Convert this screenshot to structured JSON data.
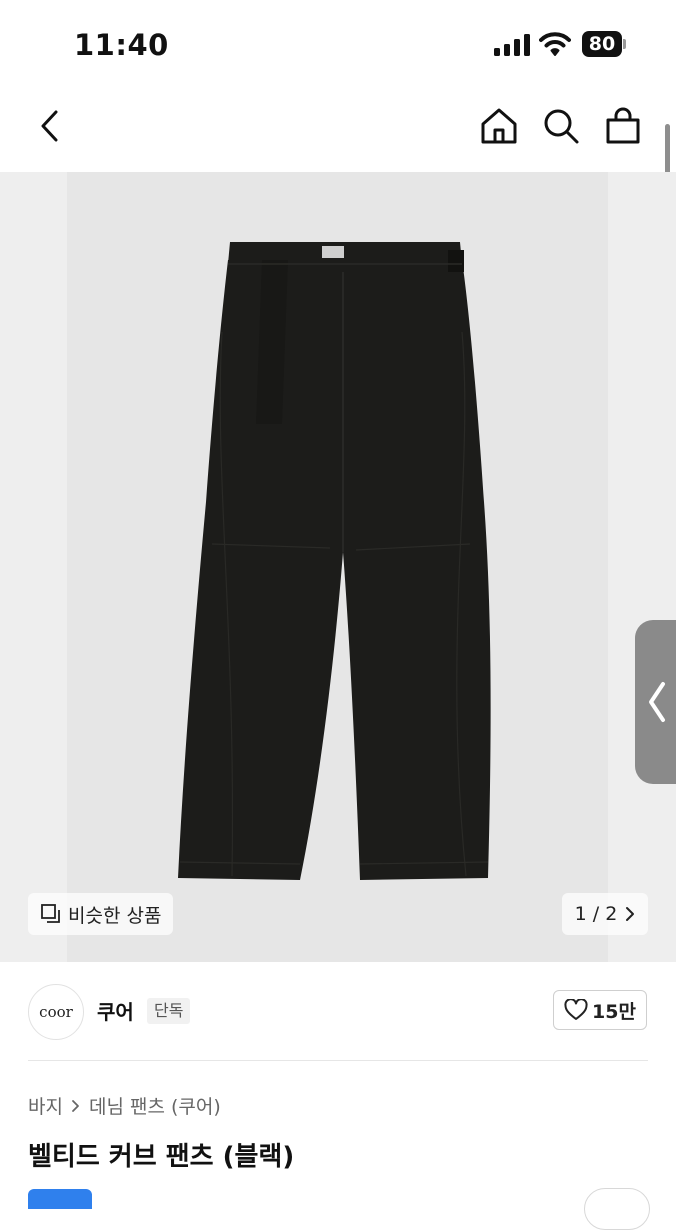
{
  "status_bar": {
    "time": "11:40",
    "battery": "80"
  },
  "nav": {
    "back_icon": "chevron-left-icon",
    "home_icon": "home-icon",
    "search_icon": "search-icon",
    "cart_icon": "shopping-bag-icon"
  },
  "gallery": {
    "similar_label": "비슷한 상품",
    "page_indicator": "1 / 2"
  },
  "brand": {
    "logo_text": "coor",
    "name": "쿠어",
    "badge": "단독",
    "likes": "15만"
  },
  "breadcrumb": {
    "level1": "바지",
    "level2": "데님 팬츠 (쿠어)"
  },
  "product": {
    "title": "벨티드 커브 팬츠 (블랙)"
  },
  "colors": {
    "accent_blue": "#2f80ed",
    "pants": "#1c1c1a"
  }
}
